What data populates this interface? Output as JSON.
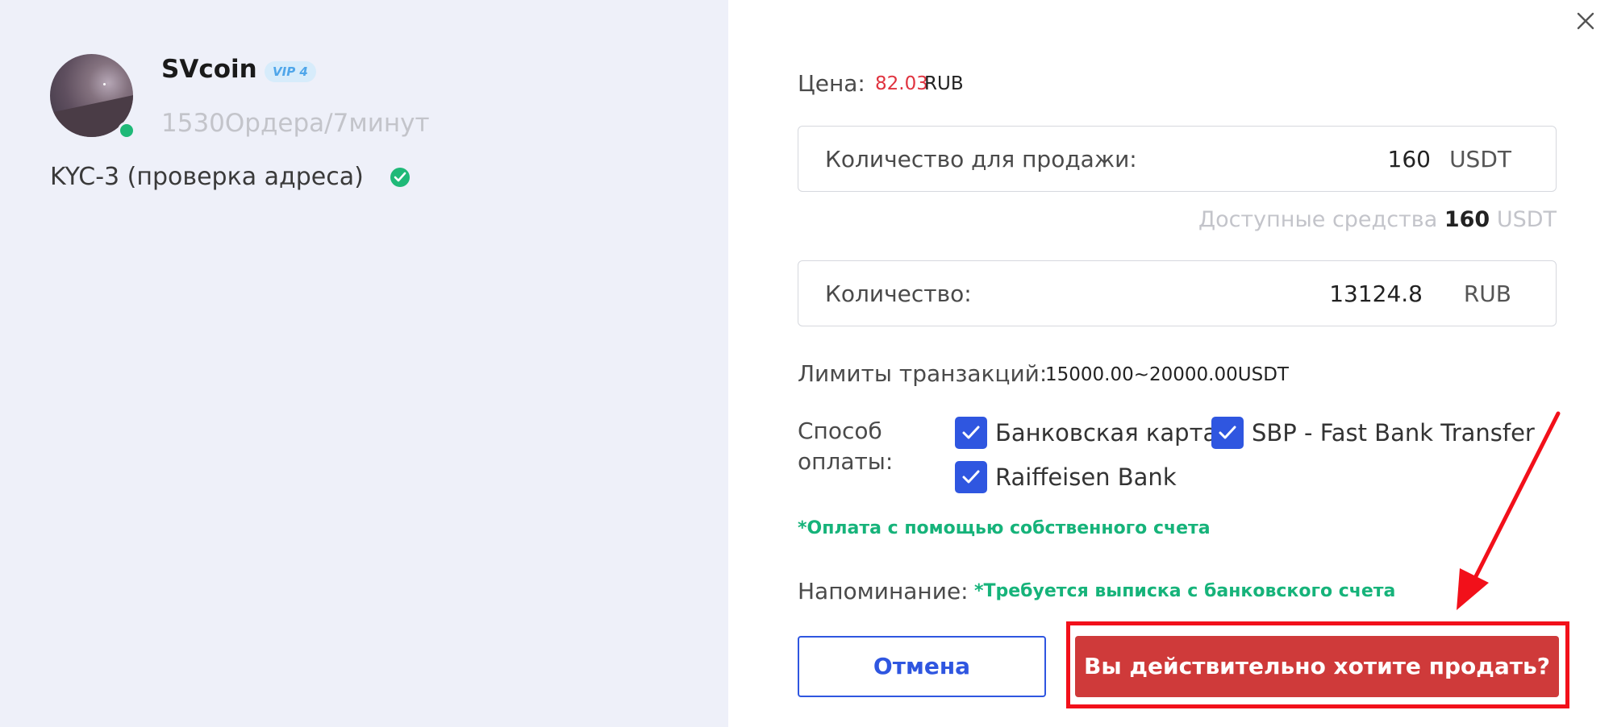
{
  "seller": {
    "name": "SVcoin",
    "vip_badge": "VIP 4",
    "stats": "1530Ордера/7минут",
    "kyc": "KYC-3 (проверка адреса)",
    "online": true
  },
  "form": {
    "price_label": "Цена:",
    "price_value": "82.03",
    "price_unit": "RUB",
    "sell_amount": {
      "label": "Количество для продажи:",
      "value": "160",
      "unit": "USDT"
    },
    "available": {
      "label": "Доступные средства",
      "value": "160",
      "unit": "USDT"
    },
    "receive_amount": {
      "label": "Количество:",
      "value": "13124.8",
      "unit": "RUB"
    },
    "limits_label": "Лимиты транзакций:",
    "limits_value": "15000.00~20000.00USDT",
    "payment_label": "Способ оплаты:",
    "payment_methods": [
      {
        "label": "Банковская карта",
        "checked": true
      },
      {
        "label": "SBP - Fast Bank Transfer",
        "checked": true
      },
      {
        "label": "Raiffeisen Bank",
        "checked": true
      }
    ],
    "own_account_note": "*Оплата с помощью собственного счета",
    "reminder_label": "Напоминание:",
    "reminder_value": "*Требуется выписка с банковского счета",
    "cancel_label": "Отмена",
    "confirm_label": "Вы действительно хотите продать?"
  },
  "colors": {
    "accent_blue": "#2f56e0",
    "confirm_red": "#cf3a3a",
    "price_red": "#e0333f",
    "note_green": "#16b37a",
    "annotation_red": "#f2101a"
  },
  "icons": {
    "close": "close-icon",
    "verified": "check-circle-icon",
    "checkbox": "checkbox-checked-icon"
  }
}
